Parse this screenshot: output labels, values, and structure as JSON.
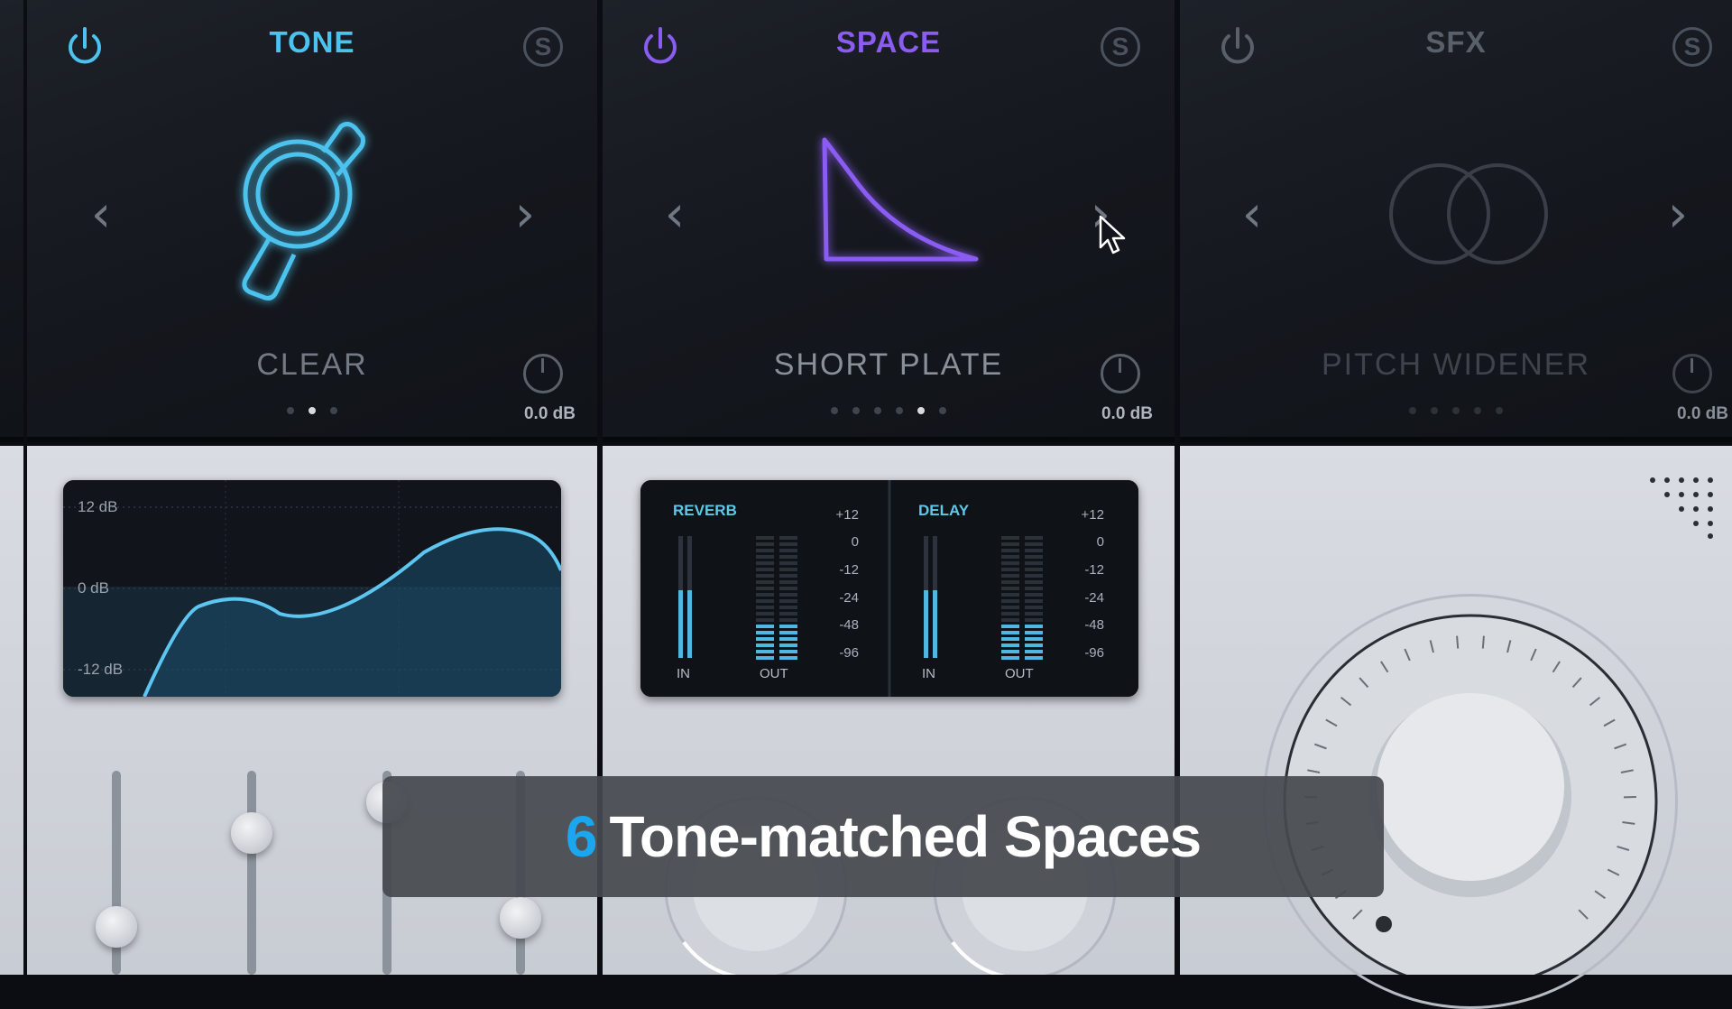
{
  "modules": [
    {
      "title": "TONE",
      "preset": "CLEAR",
      "gain": "0.0 dB",
      "solo": "S",
      "dots": 3,
      "active_dot": 1,
      "accent": "#4cc3ee"
    },
    {
      "title": "SPACE",
      "preset": "SHORT PLATE",
      "gain": "0.0 dB",
      "solo": "S",
      "dots": 6,
      "active_dot": 4,
      "accent": "#8a5cf2"
    },
    {
      "title": "SFX",
      "preset": "PITCH WIDENER",
      "gain": "0.0 dB",
      "solo": "S",
      "dots": 5,
      "active_dot": -1,
      "accent": "#5a6069"
    }
  ],
  "eq": {
    "labels": [
      "12 dB",
      "0 dB",
      "-12 dB"
    ]
  },
  "meters": {
    "reverb": {
      "title": "REVERB",
      "in": "IN",
      "out": "OUT"
    },
    "delay": {
      "title": "DELAY",
      "in": "IN",
      "out": "OUT"
    },
    "scale": [
      "+12",
      "0",
      "-12",
      "-24",
      "-48",
      "-96"
    ]
  },
  "caption": {
    "number": "6",
    "text": "Tone-matched Spaces"
  },
  "colors": {
    "tone_accent": "#4cc3ee",
    "space_accent": "#8a5cf2",
    "caption_number": "#1aa7f0"
  }
}
